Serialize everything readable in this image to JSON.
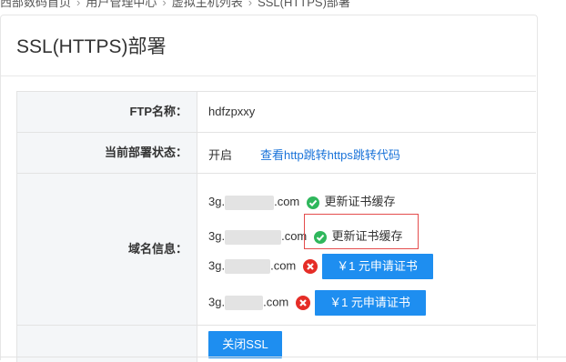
{
  "breadcrumb": [
    "西部数码首页",
    "用户管理中心",
    "虚拟主机列表",
    "SSL(HTTPS)部署"
  ],
  "page_title": "SSL(HTTPS)部署",
  "rows": {
    "ftp": {
      "label": "FTP名称：",
      "value": "hdfzpxxy"
    },
    "status": {
      "label": "当前部署状态：",
      "value": "开启",
      "link": "查看http跳转https跳转代码"
    },
    "domains": {
      "label": "域名信息：",
      "items": [
        {
          "prefix": "3g.",
          "suffix": ".com",
          "status": "ok",
          "action": "更新证书缓存"
        },
        {
          "prefix": "3g.",
          "suffix": ".com",
          "status": "ok",
          "action": "更新证书缓存"
        },
        {
          "prefix": "3g.",
          "suffix": ".com",
          "status": "error",
          "action": "￥1 元申请证书"
        },
        {
          "prefix": "3g.",
          "suffix": ".com",
          "status": "error",
          "action": "￥1 元申请证书"
        }
      ]
    }
  },
  "close_ssl_button": "关闭SSL",
  "colors": {
    "accent": "#1e8ef0",
    "ok": "#2fb75c",
    "error": "#e52d27",
    "highlight": "#e44c4c"
  }
}
